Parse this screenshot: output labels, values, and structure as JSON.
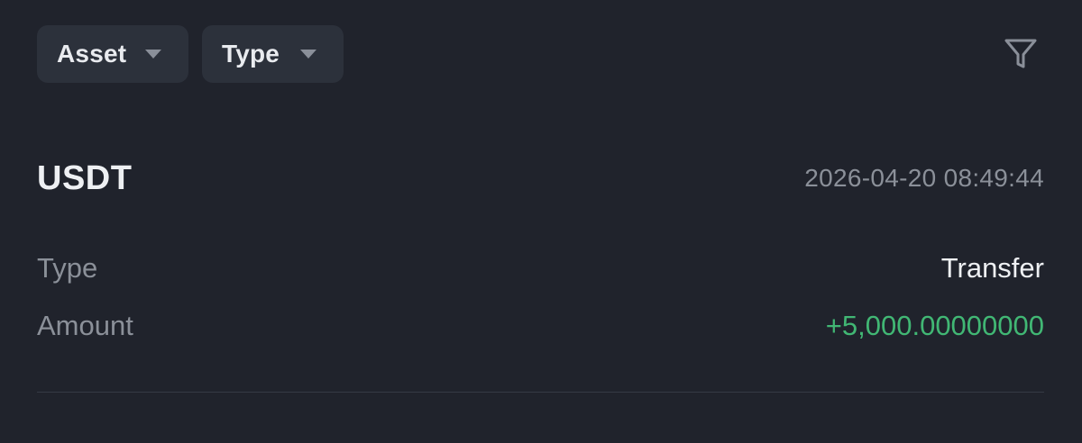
{
  "filters": {
    "asset_label": "Asset",
    "type_label": "Type",
    "filter_icon": "funnel-icon"
  },
  "record": {
    "asset": "USDT",
    "timestamp": "2026-04-20 08:49:44",
    "type_label": "Type",
    "type_value": "Transfer",
    "amount_label": "Amount",
    "amount_value": "+5,000.00000000"
  },
  "colors": {
    "background": "#20232c",
    "chip_background": "#2c313b",
    "positive": "#41b774",
    "muted_text": "#8b9099",
    "primary_text": "#eef0f3"
  }
}
